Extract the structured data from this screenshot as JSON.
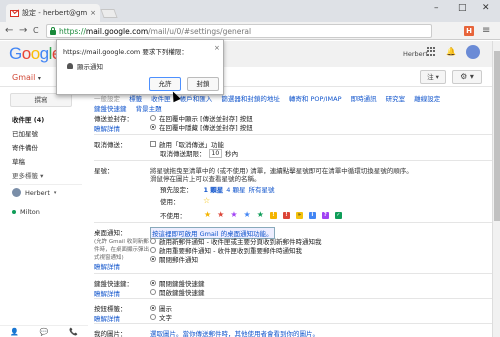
{
  "browser": {
    "tab_title": "設定 - herbert@gm",
    "tab_close": "×",
    "url_https": "https://",
    "url_host": "mail.google.com",
    "url_path": "/mail/u/0/#settings/general",
    "ext_label": "H",
    "win_min": "–",
    "win_max": "□",
    "win_close": "✕",
    "back": "←",
    "forward": "→",
    "reload": "C",
    "menu": "≡"
  },
  "gmail": {
    "user_name": "Herbert",
    "gmail_label": "Gmail",
    "gmail_caret": "▾",
    "lang_btn": "注 ▾",
    "gear_btn": "⚙ ▾"
  },
  "sidebar": {
    "compose": "撰寫",
    "items": [
      "收件匣 (4)",
      "已加星號",
      "寄件備份",
      "草稿",
      "更多標籤"
    ],
    "more_caret": "▾",
    "chat": [
      {
        "name": "Herbert"
      },
      {
        "name": "Milton"
      }
    ],
    "footer_icons": [
      "👤",
      "💬",
      "📞"
    ]
  },
  "permission": {
    "title": "https://mail.google.com 要求下列權限：",
    "close": "×",
    "item": "顯示通知",
    "allow": "允許",
    "block": "封鎖"
  },
  "settings": {
    "tabs": [
      "一般設定",
      "標籤",
      "收件匣",
      "帳戶和匯入",
      "篩選器和封鎖的地址",
      "轉寄和 POP/IMAP",
      "即時通訊",
      "研究室",
      "離線設定"
    ],
    "tabs2": [
      "鍵盤快速鍵",
      "背景主題"
    ],
    "sent_label": "傳送並封存：",
    "sent_label_link": "瞭解詳情",
    "sent_opt1": "在回覆中顯示 [傳送並封存] 按鈕",
    "sent_opt2": "在回覆中隱藏 [傳送並封存] 按鈕",
    "undo_label": "取消傳送：",
    "undo_opt": "啟用「取消傳送」功能",
    "undo_period_label": "取消傳送期限：",
    "undo_period_value": "10",
    "undo_period_unit": "秒內",
    "stars_label": "星號：",
    "stars_desc": "將星號拖曳至清單中的 (或不使用) 清單，連續點擊星號即可在清單中循環切換星號的順序。",
    "stars_desc2": "滑鼠停在圖片上可以查看星號的名稱。",
    "stars_presets_label": "預先設定：",
    "stars_preset1": "1 顆星",
    "stars_preset4": "4 顆星",
    "stars_preset_all": "所有星號",
    "stars_use_label": "使用：",
    "stars_unused_label": "不使用：",
    "desk_label": "桌面通知：",
    "desk_label_sub": "(允許 Gmail 收到新郵件時，在桌面顯示彈出式視窗通知)",
    "desk_label_link": "瞭解詳情",
    "desk_link_text": "按這裡即可啟用 Gmail 的桌面通知功能。",
    "desk_opt1": "啟用新郵件通知 - 收件匣或主要分頁收到新郵件時通知我",
    "desk_opt2": "啟用重要郵件通知 - 收件匣收到重要郵件時通知我",
    "desk_opt3": "關閉郵件通知",
    "kbd_label": "鍵盤快速鍵：",
    "kbd_label_link": "瞭解詳情",
    "kbd_opt1": "關閉鍵盤快速鍵",
    "kbd_opt2": "開啟鍵盤快速鍵",
    "btn_label": "按鈕標籤：",
    "btn_label_link": "瞭解詳情",
    "btn_opt1": "圖示",
    "btn_opt2": "文字",
    "pic_label": "我的圖片：",
    "pic_text": "選取圖片。當你傳送郵件時，其他使用者會看到你的圖片。"
  },
  "colors": {
    "accent_link": "#1155cc",
    "gmail_red": "#d14836",
    "tab_bg": "#dee1e6"
  }
}
